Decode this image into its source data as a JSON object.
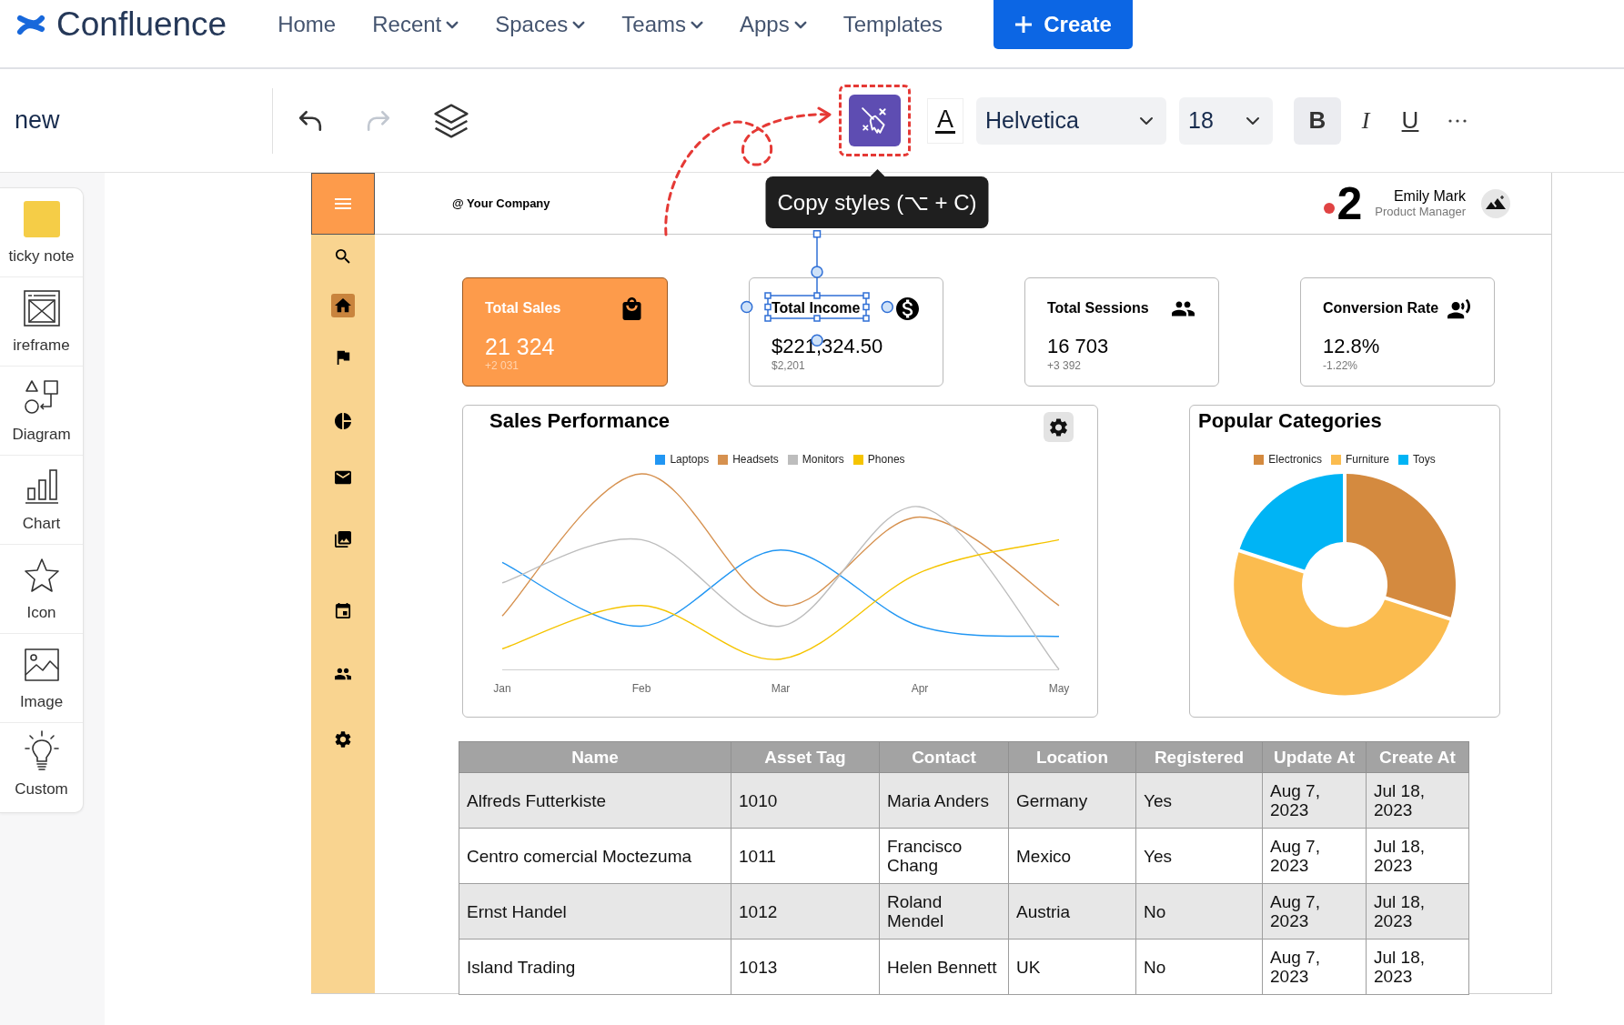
{
  "top_nav": {
    "brand": "Confluence",
    "items": [
      {
        "label": "Home",
        "dropdown": false
      },
      {
        "label": "Recent",
        "dropdown": true
      },
      {
        "label": "Spaces",
        "dropdown": true
      },
      {
        "label": "Teams",
        "dropdown": true
      },
      {
        "label": "Apps",
        "dropdown": true
      },
      {
        "label": "Templates",
        "dropdown": false
      }
    ],
    "create": "Create"
  },
  "toolbar": {
    "page_title": "new",
    "undo": {
      "disabled": false
    },
    "redo": {
      "disabled": true
    },
    "copy_styles": {
      "active": true,
      "highlighted": true,
      "tooltip": "Copy styles (⌥ + C)"
    },
    "text_color": {
      "label": "A"
    },
    "font_family": "Helvetica",
    "font_size": "18",
    "formats": [
      {
        "label": "B",
        "kind": "bold",
        "active": true
      },
      {
        "label": "I",
        "kind": "italic",
        "active": false
      },
      {
        "label": "U",
        "kind": "underline",
        "active": false
      }
    ]
  },
  "shape_panel": {
    "items": [
      {
        "label": "ticky note"
      },
      {
        "label": "ireframe"
      },
      {
        "label": "Diagram"
      },
      {
        "label": "Chart"
      },
      {
        "label": "Icon"
      },
      {
        "label": "Image"
      },
      {
        "label": "Custom"
      }
    ]
  },
  "dashboard": {
    "sidebar": {
      "items": [
        {
          "selected": false
        },
        {
          "selected": true
        },
        {
          "selected": false
        },
        {
          "selected": false
        },
        {
          "selected": false
        },
        {
          "selected": false
        },
        {
          "selected": false
        },
        {
          "selected": false
        },
        {
          "selected": false
        }
      ]
    },
    "company": "@ Your Company",
    "notification_count": "2",
    "user": {
      "name": "Emily Mark",
      "role": "Product Manager"
    },
    "cards": [
      {
        "kind": "accent",
        "title": "Total Sales",
        "value": "21 324",
        "delta": "+2 031",
        "selected": false
      },
      {
        "kind": "plain",
        "title": "Total Income",
        "value": "$221,324.50",
        "delta": "$2,201",
        "selected": true
      },
      {
        "kind": "plain",
        "title": "Total Sessions",
        "value": "16 703",
        "delta": "+3 392",
        "selected": false
      },
      {
        "kind": "plain",
        "title": "Conversion Rate",
        "value": "12.8%",
        "delta": "-1.22%",
        "selected": false
      }
    ],
    "sales_chart": {
      "title": "Sales Performance",
      "series": [
        {
          "name": "Laptops",
          "color": "#2196f3"
        },
        {
          "name": "Headsets",
          "color": "#d6914f"
        },
        {
          "name": "Monitors",
          "color": "#bdbdbd"
        },
        {
          "name": "Phones",
          "color": "#f5c400"
        }
      ],
      "x_labels": [
        "Jan",
        "Feb",
        "Mar",
        "Apr",
        "May"
      ]
    },
    "categories_chart": {
      "chart_data": {
        "type": "donut",
        "title": "Popular Categories",
        "categories": [
          "Electronics",
          "Furniture",
          "Toys"
        ],
        "values": [
          30,
          50,
          20
        ],
        "colors": [
          "#d48a3f",
          "#fbbc4f",
          "#00b4f5"
        ]
      }
    },
    "table": {
      "columns": [
        "Name",
        "Asset Tag",
        "Contact",
        "Location",
        "Registered",
        "Update At",
        "Create At"
      ],
      "rows": [
        [
          "Alfreds Futterkiste",
          "1010",
          "Maria Anders",
          "Germany",
          "Yes",
          "Aug 7, 2023",
          "Jul 18, 2023"
        ],
        [
          "Centro comercial Moctezuma",
          "1011",
          "Francisco Chang",
          "Mexico",
          "Yes",
          "Aug 7, 2023",
          "Jul 18, 2023"
        ],
        [
          "Ernst Handel",
          "1012",
          "Roland Mendel",
          "Austria",
          "No",
          "Aug 7, 2023",
          "Jul 18, 2023"
        ],
        [
          "Island Trading",
          "1013",
          "Helen Bennett",
          "UK",
          "No",
          "Aug 7, 2023",
          "Jul 18, 2023"
        ]
      ]
    }
  }
}
